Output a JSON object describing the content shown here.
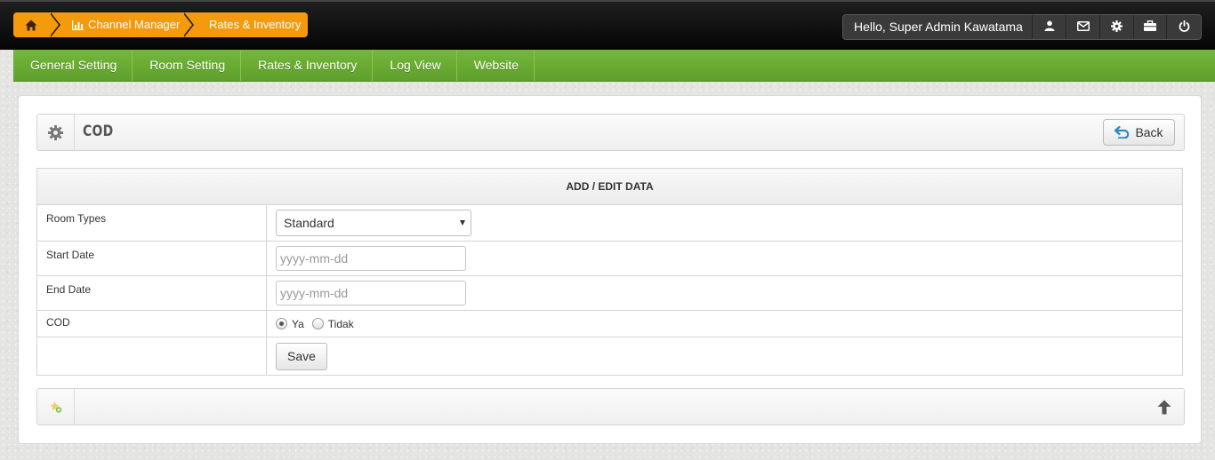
{
  "breadcrumb": {
    "home_icon": "home-icon",
    "items": [
      {
        "label": "Channel Manager",
        "icon": "bar-chart-icon"
      },
      {
        "label": "Rates & Inventory"
      }
    ]
  },
  "user": {
    "greeting": "Hello, Super Admin Kawatama",
    "actions": [
      "user-icon",
      "envelope-icon",
      "gear-icon",
      "briefcase-icon",
      "power-icon"
    ]
  },
  "nav": {
    "items": [
      "General Setting",
      "Room Setting",
      "Rates & Inventory",
      "Log View",
      "Website"
    ]
  },
  "panel": {
    "title": "COD",
    "back_label": "Back"
  },
  "form": {
    "header": "ADD / EDIT DATA",
    "room_types_label": "Room Types",
    "room_types_value": "Standard",
    "start_date_label": "Start Date",
    "start_date_placeholder": "yyyy-mm-dd",
    "end_date_label": "End Date",
    "end_date_placeholder": "yyyy-mm-dd",
    "cod_label": "COD",
    "cod_options": [
      "Ya",
      "Tidak"
    ],
    "cod_selected": "Ya",
    "save_label": "Save"
  },
  "colors": {
    "accent_orange": "#f39a0d",
    "nav_green": "#6aad33"
  }
}
